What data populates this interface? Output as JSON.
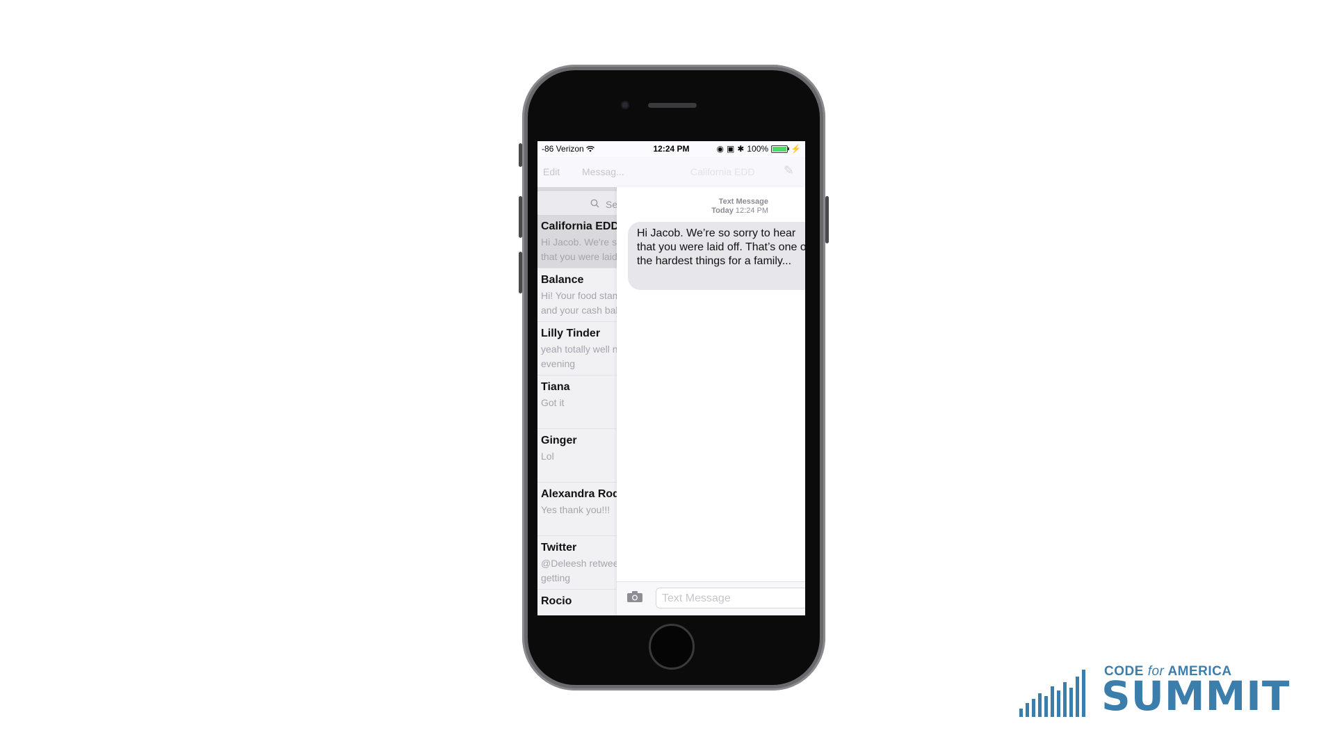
{
  "status_bar": {
    "carrier": "-86 Verizon",
    "time": "12:24 PM",
    "battery": "100%"
  },
  "nav": {
    "edit": "Edit",
    "title_left": "Messag...",
    "title_right": "California EDD"
  },
  "search": {
    "placeholder": "Se"
  },
  "conversations": [
    {
      "name": "California EDD",
      "preview": "Hi Jacob. We're so sorry to hear that you were laid off"
    },
    {
      "name": "Balance",
      "preview": "Hi! Your food stamps balance and your cash balance"
    },
    {
      "name": "Lilly Tinder",
      "preview": "yeah totally well need an evening"
    },
    {
      "name": "Tiana",
      "preview": "Got it"
    },
    {
      "name": "Ginger",
      "preview": "Lol"
    },
    {
      "name": "Alexandra Rodriguez",
      "preview": "Yes thank you!!!"
    },
    {
      "name": "Twitter",
      "preview": "@Deleesh retweeted Imagine getting"
    },
    {
      "name": "Rocio",
      "preview": ""
    }
  ],
  "thread": {
    "meta_label": "Text Message",
    "meta_day": "Today",
    "meta_time": "12:24 PM",
    "message": "Hi Jacob. We’re so sorry to hear that you were laid off. That’s one of the hardest things for a family..."
  },
  "composer": {
    "placeholder": "Text Message"
  },
  "logo": {
    "top_prefix": "CODE",
    "top_for": "for",
    "top_suffix": "AMERICA",
    "main": "SUMMIT",
    "color": "#3b7dab"
  },
  "icons": {
    "wifi": "wifi-icon",
    "battery": "battery-icon",
    "search": "search-icon",
    "compose": "compose-icon",
    "camera": "camera-icon"
  }
}
